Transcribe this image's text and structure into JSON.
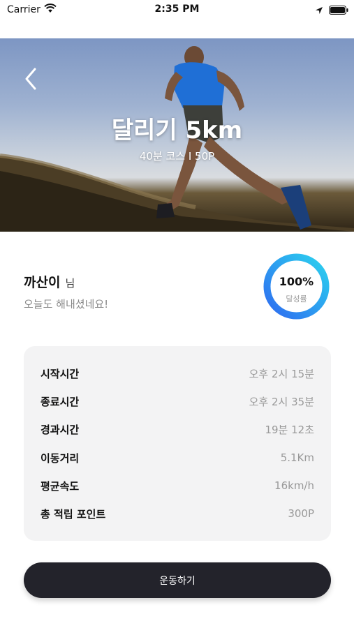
{
  "status_bar": {
    "carrier": "Carrier",
    "time": "2:35 PM"
  },
  "hero": {
    "title": "달리기 5km",
    "subtitle": "40분 코스 I  50P"
  },
  "user": {
    "name": "까산이",
    "suffix": "님",
    "message": "오늘도 해내셨네요!"
  },
  "achievement": {
    "value": "100%",
    "label": "달성률",
    "progress": 1.0,
    "gradient_start": "#2f6bf0",
    "gradient_end": "#2bd3ef"
  },
  "summary": {
    "rows": [
      {
        "label": "시작시간",
        "value": "오후 2시 15분"
      },
      {
        "label": "종료시간",
        "value": "오후 2시 35분"
      },
      {
        "label": "경과시간",
        "value": "19분 12초"
      },
      {
        "label": "이동거리",
        "value": "5.1Km"
      },
      {
        "label": "평균속도",
        "value": "16km/h"
      },
      {
        "label": "총 적립 포인트",
        "value": "300P"
      }
    ]
  },
  "cta": {
    "label": "운동하기"
  }
}
